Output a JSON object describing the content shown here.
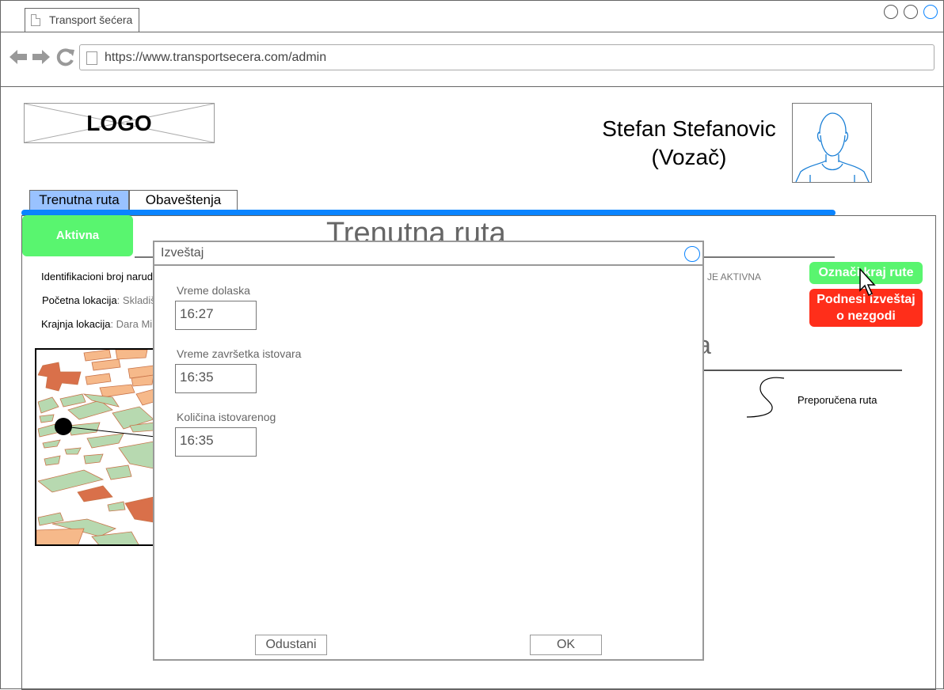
{
  "browser": {
    "tab_title": "Transport šećera",
    "url": "https://www.transportsecera.com/admin"
  },
  "header": {
    "logo": "LOGO",
    "user_name": "Stefan Stefanovic",
    "user_role": "(Vozač)"
  },
  "tabs": [
    {
      "label": "Trenutna ruta",
      "active": true
    },
    {
      "label": "Obaveštenja",
      "active": false
    }
  ],
  "main": {
    "status_button": "Aktivna",
    "title": "Trenutna ruta",
    "order_id_label": "Identifikacioni broj narud",
    "start_label": "Početna lokacija",
    "start_value": ": Skladiš",
    "end_label": "Krajnja lokacija",
    "end_value": ": Dara Mi",
    "status_text": "JE AKTIVNA",
    "end_route_button": "Označi kraj rute",
    "report_button_line1": "Podnesi izveštaj",
    "report_button_line2": "o nezgodi",
    "section2_fragment": "a",
    "legend_label": "Preporučena ruta"
  },
  "dialog": {
    "title": "Izveštaj",
    "fields": [
      {
        "label": "Vreme dolaska",
        "value": "16:27"
      },
      {
        "label": "Vreme završetka istovara",
        "value": "16:35"
      },
      {
        "label": "Količina istovarenog",
        "value": "16:35"
      }
    ],
    "cancel": "Odustani",
    "ok": "OK"
  },
  "colors": {
    "accent": "#0a84ff",
    "active_tab": "#99c2ff",
    "green": "#59f56f",
    "red": "#ff2e1a"
  }
}
